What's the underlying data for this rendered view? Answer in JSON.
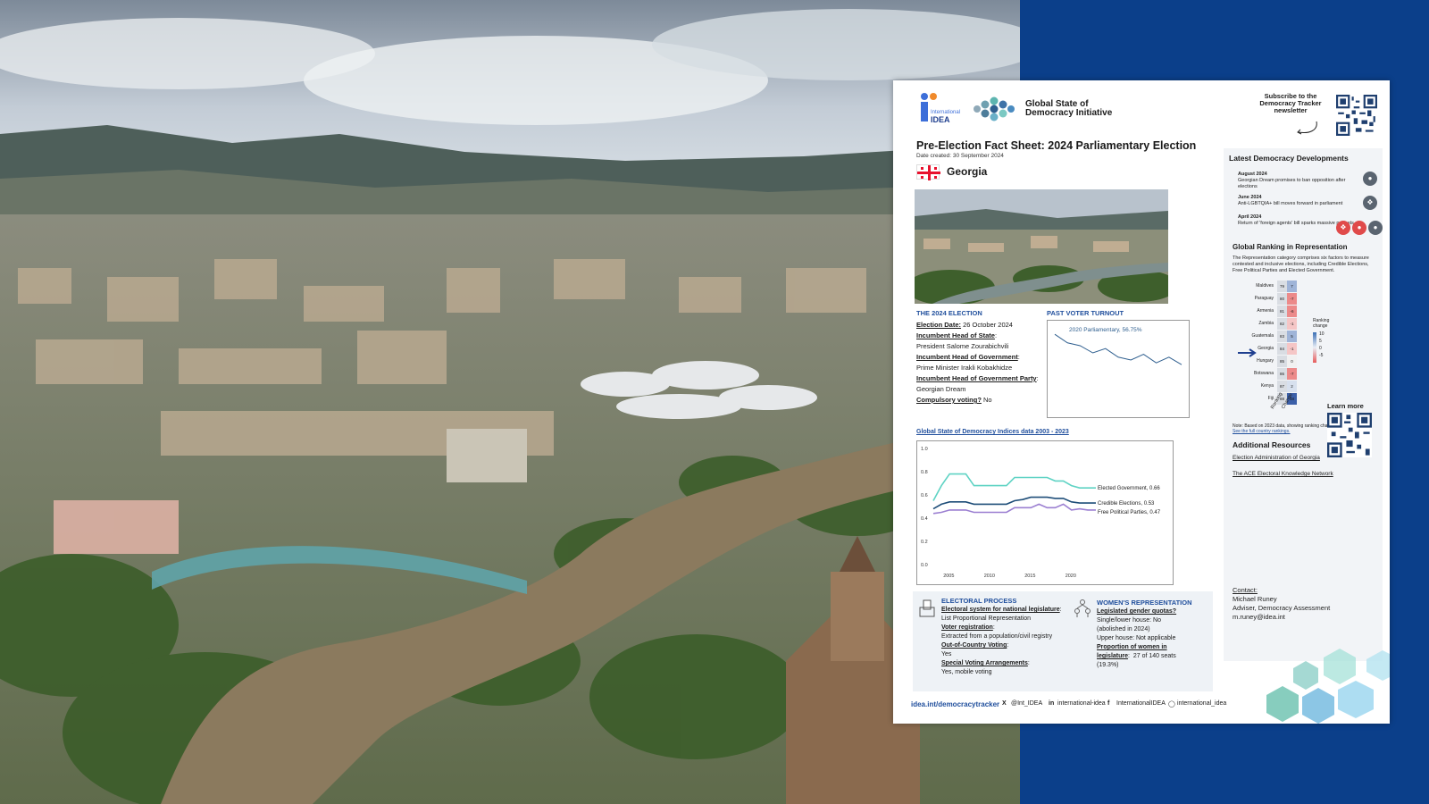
{
  "header": {
    "idea_logo_line1": "International",
    "idea_logo_line2": "IDEA",
    "gsod_title": "Global State of Democracy Initiative",
    "subscribe": "Subscribe to the Democracy Tracker newsletter"
  },
  "sheet": {
    "title": "Pre-Election Fact Sheet: 2024 Parliamentary Election",
    "date_created": "Date created: 30 September 2024",
    "country": "Georgia"
  },
  "election": {
    "heading": "THE 2024 ELECTION",
    "date_label": "Election Date:",
    "date_value": "26 October 2024",
    "head_state_label": "Incumbent Head of State",
    "head_state_value": "President Salome Zourabichvili",
    "head_gov_label": "Incumbent Head of Government",
    "head_gov_value": "Prime Minister Irakli Kobakhidze",
    "head_gov_party_label": "Incumbent Head of Government Party",
    "head_gov_party_value": "Georgian Dream",
    "compulsory_label": "Compulsory voting?",
    "compulsory_value": "No"
  },
  "turnout": {
    "heading": "PAST VOTER TURNOUT",
    "label": "2020 Parliamentary, 56.75%",
    "values": [
      0.78,
      0.72,
      0.7,
      0.65,
      0.68,
      0.62,
      0.6,
      0.64,
      0.58,
      0.62,
      0.5675
    ]
  },
  "indices": {
    "link": "Global State of Democracy Indices data 2003 - 2023",
    "series_labels": [
      "Elected Government, 0.66",
      "Credible Elections, 0.53",
      "Free Political Parties, 0.47"
    ]
  },
  "chart_data": {
    "type": "line",
    "x": [
      2003,
      2004,
      2005,
      2006,
      2007,
      2008,
      2009,
      2010,
      2011,
      2012,
      2013,
      2014,
      2015,
      2016,
      2017,
      2018,
      2019,
      2020,
      2021,
      2022,
      2023
    ],
    "ylim": [
      0,
      1.0
    ],
    "yticks": [
      "1.0",
      "0.8",
      "0.6",
      "0.4",
      "0.2",
      "0.0"
    ],
    "xticks": [
      "2005",
      "2010",
      "2015",
      "2020"
    ],
    "series": [
      {
        "name": "Elected Government, 0.66",
        "color": "#5fd3c4",
        "values": [
          0.55,
          0.68,
          0.78,
          0.78,
          0.78,
          0.68,
          0.68,
          0.68,
          0.68,
          0.68,
          0.75,
          0.75,
          0.75,
          0.75,
          0.75,
          0.72,
          0.72,
          0.68,
          0.66,
          0.66,
          0.66
        ]
      },
      {
        "name": "Credible Elections, 0.53",
        "color": "#1f4e79",
        "values": [
          0.48,
          0.52,
          0.54,
          0.54,
          0.54,
          0.52,
          0.52,
          0.52,
          0.52,
          0.52,
          0.55,
          0.56,
          0.58,
          0.58,
          0.58,
          0.57,
          0.57,
          0.54,
          0.53,
          0.53,
          0.53
        ]
      },
      {
        "name": "Free Political Parties, 0.47",
        "color": "#9b7fd1",
        "values": [
          0.44,
          0.45,
          0.47,
          0.47,
          0.47,
          0.45,
          0.45,
          0.45,
          0.45,
          0.45,
          0.49,
          0.49,
          0.49,
          0.52,
          0.49,
          0.49,
          0.52,
          0.47,
          0.48,
          0.47,
          0.47
        ]
      }
    ]
  },
  "electoral_process": {
    "heading": "ELECTORAL PROCESS",
    "sys_label": "Electoral system for national legislature",
    "sys_value": "List Proportional Representation",
    "reg_label": "Voter registration",
    "reg_value": "Extracted from a population/civil registry",
    "ocv_label": "Out-of-Country Voting",
    "ocv_value": "Yes",
    "sva_label": "Special Voting Arrangements",
    "sva_value": "Yes, mobile voting"
  },
  "women": {
    "heading": "WOMEN'S REPRESENTATION",
    "quota_label": "Legislated gender quotas?",
    "quota_v1": "Single/lower house: No",
    "quota_v2": "(abolished in 2024)",
    "quota_v3": "Upper house: Not applicable",
    "prop_label": "Proportion of women in",
    "prop_label2": "legislature",
    "prop_value": "27 of 140 seats",
    "prop_value2": "(19.3%)"
  },
  "contact": {
    "label": "Contact:",
    "name": "Michael Runey",
    "role": "Adviser, Democracy Assessment",
    "email": "m.runey@idea.int"
  },
  "latest": {
    "heading": "Latest Democracy Developments",
    "items": [
      {
        "date": "August 2024",
        "text": "Georgian Dream promises to ban opposition after elections"
      },
      {
        "date": "June 2024",
        "text": "Anti-LGBTQIA+ bill moves forward in parliament"
      },
      {
        "date": "April 2024",
        "text": "Return of 'foreign agents' bill sparks massive protests"
      }
    ]
  },
  "ranking": {
    "heading": "Global Ranking in Representation",
    "desc": "The Representation category comprises six factors to measure contested and inclusive elections, including Credible Elections, Free Political Parties and Elected Government.",
    "countries": [
      "Maldives",
      "Paraguay",
      "Armenia",
      "Zambia",
      "Guatemala",
      "Georgia",
      "Hungary",
      "Botswana",
      "Kenya",
      "Fiji"
    ],
    "ranks": [
      "79",
      "80",
      "81",
      "82",
      "83",
      "84",
      "85",
      "86",
      "87",
      "88"
    ],
    "changes": [
      "7",
      "-7",
      "-6",
      "-1",
      "5",
      "-1",
      "0",
      "-7",
      "2",
      "18"
    ],
    "legend_title": "Ranking change",
    "legend_vals": [
      "10",
      "5",
      "0",
      "-5"
    ],
    "col_ranking": "Ranking",
    "col_change": "Change",
    "note": "Note: Based on 2023 data, showing ranking change over 1 year.",
    "note_link": "See the full country rankings.",
    "learn_more": "Learn more"
  },
  "resources": {
    "heading": "Additional Resources",
    "links": [
      "Election Administration of Georgia",
      "The ACE Electoral Knowledge Network"
    ]
  },
  "footer": {
    "url": "idea.int/democracytracker",
    "x": "@Int_IDEA",
    "linkedin": "international-idea",
    "facebook": "InternationalIDEA",
    "instagram": "international_idea"
  }
}
